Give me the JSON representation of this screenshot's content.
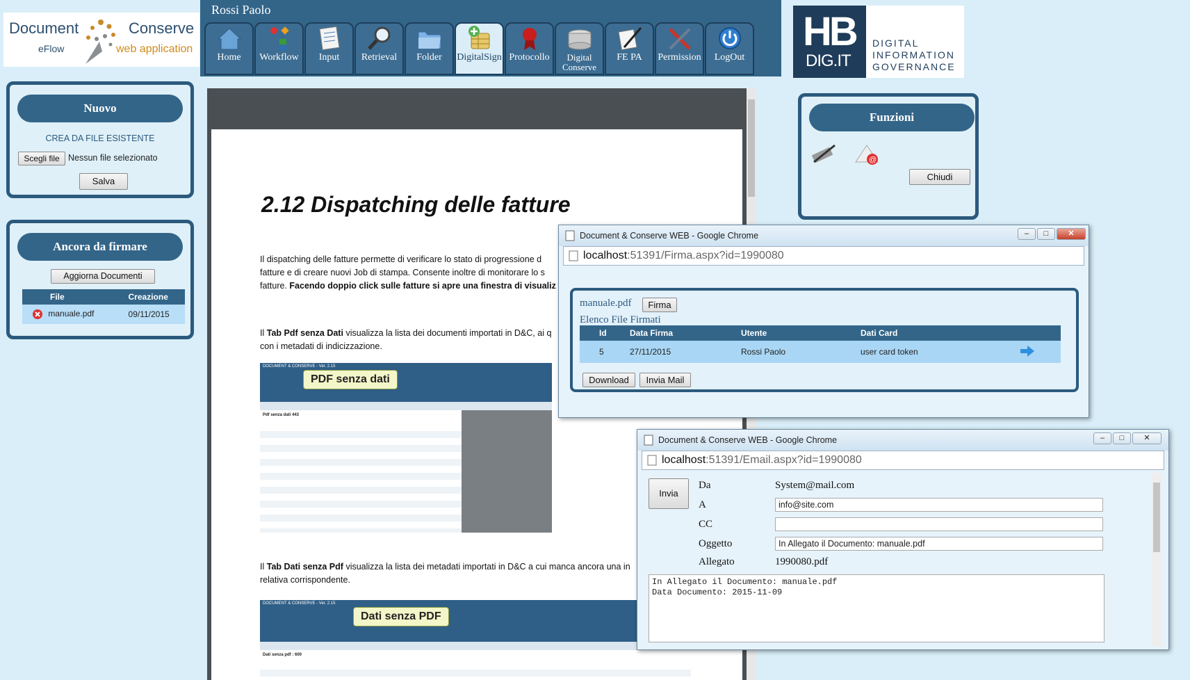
{
  "logo": {
    "word1": "Document",
    "word2": "eFlow",
    "word3": "Conserve",
    "word4": "web application"
  },
  "header": {
    "username": "Rossi Paolo"
  },
  "nav": [
    {
      "label": "Home",
      "icon": "home-icon"
    },
    {
      "label": "Workflow",
      "icon": "workflow-icon"
    },
    {
      "label": "Input",
      "icon": "input-icon"
    },
    {
      "label": "Retrieval",
      "icon": "retrieval-icon"
    },
    {
      "label": "Folder",
      "icon": "folder-icon"
    },
    {
      "label": "DigitalSign",
      "icon": "digitalsign-icon",
      "active": true
    },
    {
      "label": "Protocollo",
      "icon": "protocollo-icon"
    },
    {
      "label": "Digital Conserve",
      "icon": "conserve-icon"
    },
    {
      "label": "FE PA",
      "icon": "fepa-icon"
    },
    {
      "label": "Permission",
      "icon": "permission-icon"
    },
    {
      "label": "LogOut",
      "icon": "logout-icon"
    }
  ],
  "brand": {
    "mark": "HB",
    "sub": "DIG.IT",
    "line1": "DIGITAL",
    "line2": "INFORMATION",
    "line3": "GOVERNANCE"
  },
  "nuovo": {
    "title": "Nuovo",
    "subtitle": "CREA DA FILE ESISTENTE",
    "choose_label": "Scegli file",
    "no_file": "Nessun file selezionato",
    "save_label": "Salva"
  },
  "ancora": {
    "title": "Ancora da firmare",
    "refresh_label": "Aggiorna Documenti",
    "columns": [
      "File",
      "Creazione"
    ],
    "rows": [
      {
        "file": "manuale.pdf",
        "date": "09/11/2015"
      }
    ]
  },
  "funzioni": {
    "title": "Funzioni",
    "close_label": "Chiudi"
  },
  "doc": {
    "heading": "2.12 Dispatching delle fatture",
    "p1a": "Il dispatching delle fatture permette di verificare lo stato di progressione d",
    "p1b": "fatture e di creare nuovi Job di stampa. Consente inoltre di monitorare lo s",
    "p1c": "fatture.",
    "p1d": "Facendo doppio click sulle fatture si apre una finestra di visualiz",
    "p2a_bold": "Tab Pdf senza Dati",
    "p2a_pre": "Il",
    "p2a_post": "visualizza la lista dei documenti importati in D&C, ai q",
    "p2b": "con i metadati di indicizzazione.",
    "callout1": "PDF senza dati",
    "p3a_pre": "Il",
    "p3a_bold": "Tab Dati senza Pdf",
    "p3a_post": "visualizza la lista dei metadati importati in D&C a cui manca ancora una in",
    "p3b": "relativa corrispondente.",
    "callout2": "Dati senza PDF",
    "shot_title": "DOCUMENT & CONSERVE - Ver. 2.15",
    "shot1_count": "Pdf senza dati 443",
    "shot2_count": "Dati senza pdf : 600"
  },
  "firma_window": {
    "title": "Document & Conserve WEB - Google Chrome",
    "url_host": "localhost",
    "url_path": ":51391/Firma.aspx?id=1990080",
    "file_name": "manuale.pdf",
    "sign_label": "Firma",
    "list_title": "Elenco File Firmati",
    "columns": [
      "Id",
      "Data Firma",
      "Utente",
      "Dati Card"
    ],
    "rows": [
      {
        "id": "5",
        "date": "27/11/2015",
        "user": "Rossi Paolo",
        "card": "user card token"
      }
    ],
    "download_label": "Download",
    "mail_label": "Invia Mail"
  },
  "email_window": {
    "title": "Document & Conserve WEB - Google Chrome",
    "url_host": "localhost",
    "url_path": ":51391/Email.aspx?id=1990080",
    "send_label": "Invia",
    "da_label": "Da",
    "da_value": "System@mail.com",
    "a_label": "A",
    "a_value": "info@site.com",
    "cc_label": "CC",
    "cc_value": "",
    "oggetto_label": "Oggetto",
    "oggetto_value": "In Allegato il Documento: manuale.pdf",
    "allegato_label": "Allegato",
    "allegato_value": "1990080.pdf",
    "body_line1": "In Allegato il Documento: manuale.pdf",
    "body_line2": "Data Documento: 2015-11-09"
  }
}
